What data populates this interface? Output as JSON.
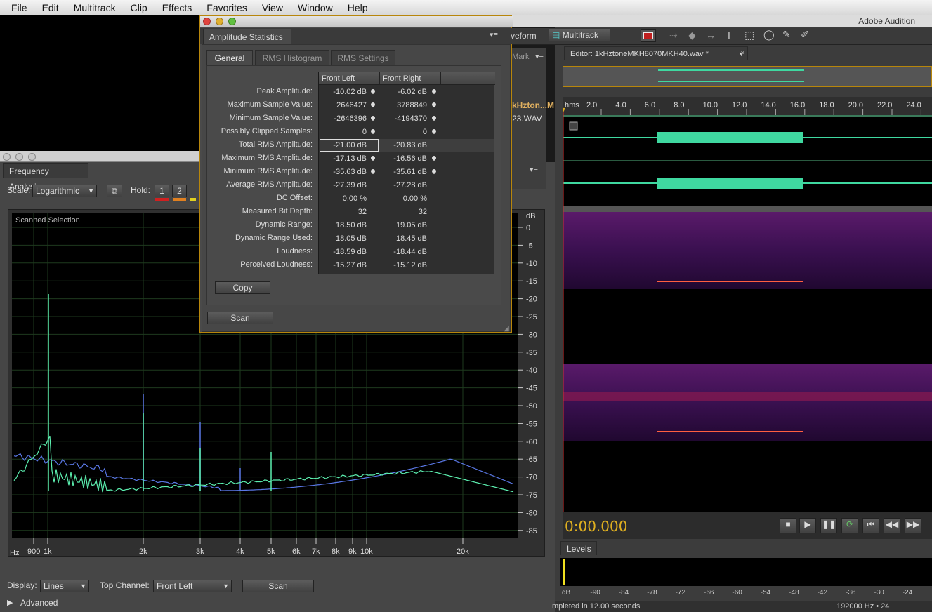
{
  "menu": [
    "File",
    "Edit",
    "Multitrack",
    "Clip",
    "Effects",
    "Favorites",
    "View",
    "Window",
    "Help"
  ],
  "app_title": "Adobe Audition",
  "freq": {
    "tab": "Frequency Analysis",
    "scale_label": "Scale:",
    "scale_value": "Logarithmic",
    "hold_label": "Hold:",
    "hold_buttons": [
      "1",
      "2"
    ],
    "plot_title": "Scanned Selection",
    "db_unit": "dB",
    "db_ticks": [
      "0",
      "-5",
      "-10",
      "-15",
      "-20",
      "-25",
      "-30",
      "-35",
      "-40",
      "-45",
      "-50",
      "-55",
      "-60",
      "-65",
      "-70",
      "-75",
      "-80",
      "-85"
    ],
    "hz_unit": "Hz",
    "hz_ticks": [
      "900",
      "1k",
      "2k",
      "3k",
      "4k",
      "5k",
      "6k",
      "7k",
      "8k",
      "9k",
      "10k",
      "20k"
    ],
    "display_label": "Display:",
    "display_value": "Lines",
    "top_channel_label": "Top Channel:",
    "top_channel_value": "Front Left",
    "scan_label": "Scan",
    "advanced_label": "Advanced",
    "colors": {
      "front_left": "#5cf0b0",
      "front_right": "#5a78e6"
    }
  },
  "amp": {
    "title": "Amplitude Statistics",
    "tabs": [
      "General",
      "RMS Histogram",
      "RMS Settings"
    ],
    "col_headers": [
      "Front Left",
      "Front Right"
    ],
    "rows": [
      {
        "label": "Peak Amplitude:",
        "l": "-10.02 dB",
        "r": "-6.02 dB",
        "dot": true
      },
      {
        "label": "Maximum Sample Value:",
        "l": "2646427",
        "r": "3788849",
        "dot": true
      },
      {
        "label": "Minimum Sample Value:",
        "l": "-2646396",
        "r": "-4194370",
        "dot": true
      },
      {
        "label": "Possibly Clipped Samples:",
        "l": "0",
        "r": "0",
        "dot": true
      },
      {
        "label": "Total RMS Amplitude:",
        "l": "-21.00 dB",
        "r": "-20.83 dB",
        "dot": false
      },
      {
        "label": "Maximum RMS Amplitude:",
        "l": "-17.13 dB",
        "r": "-16.56 dB",
        "dot": true
      },
      {
        "label": "Minimum RMS Amplitude:",
        "l": "-35.63 dB",
        "r": "-35.61 dB",
        "dot": true
      },
      {
        "label": "Average RMS Amplitude:",
        "l": "-27.39 dB",
        "r": "-27.28 dB",
        "dot": false
      },
      {
        "label": "DC Offset:",
        "l": "0.00 %",
        "r": "0.00 %",
        "dot": false
      },
      {
        "label": "Measured Bit Depth:",
        "l": "32",
        "r": "32",
        "dot": false
      },
      {
        "label": "Dynamic Range:",
        "l": "18.50 dB",
        "r": "19.05 dB",
        "dot": false
      },
      {
        "label": "Dynamic Range Used:",
        "l": "18.05 dB",
        "r": "18.45 dB",
        "dot": false
      },
      {
        "label": "Loudness:",
        "l": "-18.59 dB",
        "r": "-18.44 dB",
        "dot": false
      },
      {
        "label": "Perceived Loudness:",
        "l": "-15.27 dB",
        "r": "-15.12 dB",
        "dot": false
      }
    ],
    "copy_label": "Copy",
    "scan_label": "Scan"
  },
  "editor": {
    "tab": "Editor: 1kHztoneMKH8070MKH40.wav *",
    "waveform_label": "veform",
    "multitrack_label": "Multitrack",
    "marker_label": "Mark",
    "file_label1": "kHzton...M",
    "file_label2": "23.WAV",
    "time_unit": "hms",
    "time_ticks": [
      "2.0",
      "4.0",
      "6.0",
      "8.0",
      "10.0",
      "12.0",
      "14.0",
      "16.0",
      "18.0",
      "20.0",
      "22.0",
      "24.0"
    ],
    "time_display": "0:00.000",
    "levels_tab": "Levels",
    "level_ticks": [
      "dB",
      "-90",
      "-84",
      "-78",
      "-72",
      "-66",
      "-60",
      "-54",
      "-48",
      "-42",
      "-36",
      "-30",
      "-24"
    ],
    "status_left": "mpleted in 12.00 seconds",
    "status_right": "192000 Hz • 24"
  }
}
